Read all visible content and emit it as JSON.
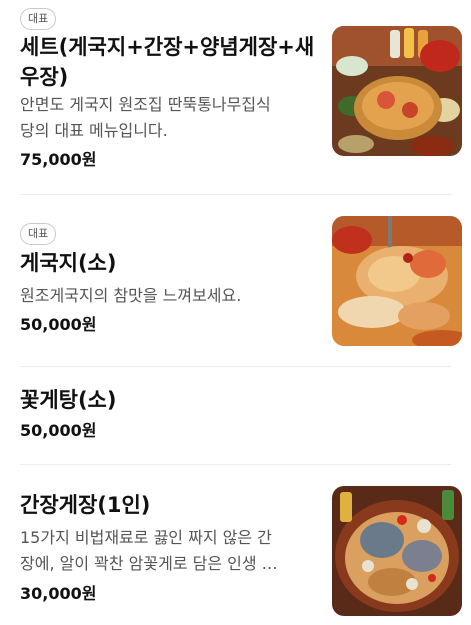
{
  "menu_items": [
    {
      "badge": "대표",
      "name": "세트(게국지+간장+양념게장+새\n우장)",
      "description": "안면도 게국지 원조집 딴뚝통나무집식\n당의 대표 메뉴입니다.",
      "price": "75,000원",
      "image": "crab-set-photo"
    },
    {
      "badge": "대표",
      "name": "게국지(소)",
      "description": "원조게국지의 참맛을 느껴보세요.",
      "price": "50,000원",
      "image": "crab-stew-photo"
    },
    {
      "name": "꽃게탕(소)",
      "price": "50,000원"
    },
    {
      "name": "간장게장(1인)",
      "description": "15가지 비법재료로 끓인 짜지 않은 간\n장에, 알이 꽉찬 암꽃게로 담은 인생 …",
      "price": "30,000원",
      "image": "soy-crab-photo"
    }
  ],
  "colors": {
    "divider": "#ececec",
    "badge_border": "#c9c9c9",
    "text": "#111111",
    "muted": "#555555"
  }
}
